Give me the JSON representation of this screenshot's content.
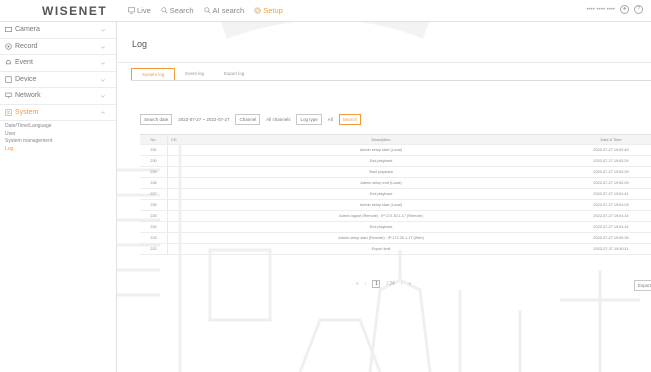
{
  "brand": {
    "logo": "WISENET",
    "accent": "#f29b3a"
  },
  "topnav": {
    "items": [
      {
        "label": "Live",
        "icon": "monitor-icon",
        "active": false
      },
      {
        "label": "Search",
        "icon": "search-icon",
        "active": false
      },
      {
        "label": "AI search",
        "icon": "ai-search-icon",
        "active": false
      },
      {
        "label": "Setup",
        "icon": "gear-icon",
        "active": true
      }
    ],
    "user": "•••• •••• ••••"
  },
  "sidebar": {
    "items": [
      {
        "label": "Camera",
        "icon": "camera-icon"
      },
      {
        "label": "Record",
        "icon": "record-icon"
      },
      {
        "label": "Event",
        "icon": "bell-icon"
      },
      {
        "label": "Device",
        "icon": "device-icon"
      },
      {
        "label": "Network",
        "icon": "network-icon"
      },
      {
        "label": "System",
        "icon": "system-icon",
        "active": true
      }
    ],
    "system_sub": [
      {
        "label": "Date/Time/Language"
      },
      {
        "label": "User"
      },
      {
        "label": "System management"
      },
      {
        "label": "Log",
        "active": true
      }
    ]
  },
  "main": {
    "title": "Log",
    "tabs": [
      {
        "label": "System log",
        "active": true
      },
      {
        "label": "Event log",
        "active": false
      },
      {
        "label": "Export log",
        "active": false
      }
    ],
    "filter": {
      "search_date": "Search date",
      "date_range": "2022-07-27 ~ 2022-07-27",
      "channel_btn": "Channel",
      "channel_val": "All channels",
      "logtype_btn": "Log type",
      "logtype_val": "All",
      "search_btn": "Search"
    },
    "table": {
      "headers": {
        "no": "No.",
        "ch": "CH",
        "desc": "Description",
        "date": "Date & Time"
      },
      "rows": [
        {
          "no": "231",
          "desc": "Admin setup start (Local)",
          "date": "2022-07-27 19:52:49"
        },
        {
          "no": "230",
          "desc": "End playback",
          "date": "2022-07-27 19:52:29"
        },
        {
          "no": "229",
          "desc": "Start playback",
          "date": "2022-07-27 19:52:29"
        },
        {
          "no": "228",
          "desc": "Admin setup end (Local)",
          "date": "2022-07-27 19:52:29"
        },
        {
          "no": "227",
          "desc": "End playback",
          "date": "2022-07-27 19:51:41"
        },
        {
          "no": "226",
          "desc": "Admin setup start (Local)",
          "date": "2022-07-27 19:51:03"
        },
        {
          "no": "225",
          "desc": "Admin logout (Remote) : IP:172.30.1.17 (Remote)",
          "date": "2022-07-27 19:51:14"
        },
        {
          "no": "224",
          "desc": "End playback",
          "date": "2022-07-27 19:51:14"
        },
        {
          "no": "223",
          "desc": "Admin setup start (Remote) : IP:172.30.1.17 (Web)",
          "date": "2022-07-27 19:50:39"
        },
        {
          "no": "222",
          "desc": "Export limit",
          "date": "2022-07-27 19:50:11"
        }
      ]
    },
    "pager": {
      "first": "«",
      "prev": "‹",
      "current": "1",
      "of": "/ 24",
      "next": "›",
      "last": "»"
    },
    "export_btn": "Export"
  }
}
